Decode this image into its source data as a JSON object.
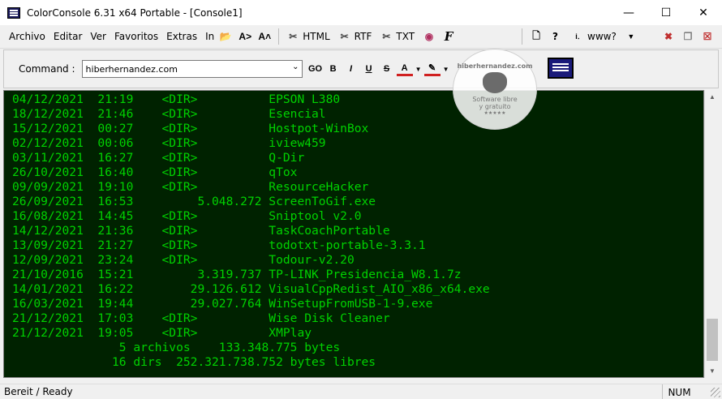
{
  "window": {
    "title": "ColorConsole 6.31 x64 Portable - [Console1]"
  },
  "menu": {
    "items": [
      "Archivo",
      "Editar",
      "Ver",
      "Favoritos",
      "Extras",
      "In"
    ],
    "html_label": "HTML",
    "rtf_label": "RTF",
    "txt_label": "TXT",
    "help_label": "?",
    "www_label": "www?"
  },
  "commandbar": {
    "label": "Command :",
    "input_value": "hiberhernandez.com"
  },
  "watermark": {
    "site": "hiberhernandez.com",
    "tagline_1": "Software libre",
    "tagline_2": "y gratuito",
    "stars": "★★★★★"
  },
  "console": {
    "lines": [
      "04/12/2021  21:19    <DIR>          EPSON L380",
      "18/12/2021  21:46    <DIR>          Esencial",
      "15/12/2021  00:27    <DIR>          Hostpot-WinBox",
      "02/12/2021  00:06    <DIR>          iview459",
      "03/11/2021  16:27    <DIR>          Q-Dir",
      "26/10/2021  16:40    <DIR>          qTox",
      "09/09/2021  19:10    <DIR>          ResourceHacker",
      "26/09/2021  16:53         5.048.272 ScreenToGif.exe",
      "16/08/2021  14:45    <DIR>          Sniptool v2.0",
      "14/12/2021  21:36    <DIR>          TaskCoachPortable",
      "13/09/2021  21:27    <DIR>          todotxt-portable-3.3.1",
      "12/09/2021  23:24    <DIR>          Todour-v2.20",
      "21/10/2016  15:21         3.319.737 TP-LINK_Presidencia_W8.1.7z",
      "14/01/2021  16:22        29.126.612 VisualCppRedist_AIO_x86_x64.exe",
      "16/03/2021  19:44        29.027.764 WinSetupFromUSB-1-9.exe",
      "21/12/2021  17:03    <DIR>          Wise Disk Cleaner",
      "21/12/2021  19:05    <DIR>          XMPlay",
      "               5 archivos    133.348.775 bytes",
      "              16 dirs  252.321.738.752 bytes libres"
    ]
  },
  "status": {
    "text": "Bereit / Ready",
    "num": "NUM"
  }
}
